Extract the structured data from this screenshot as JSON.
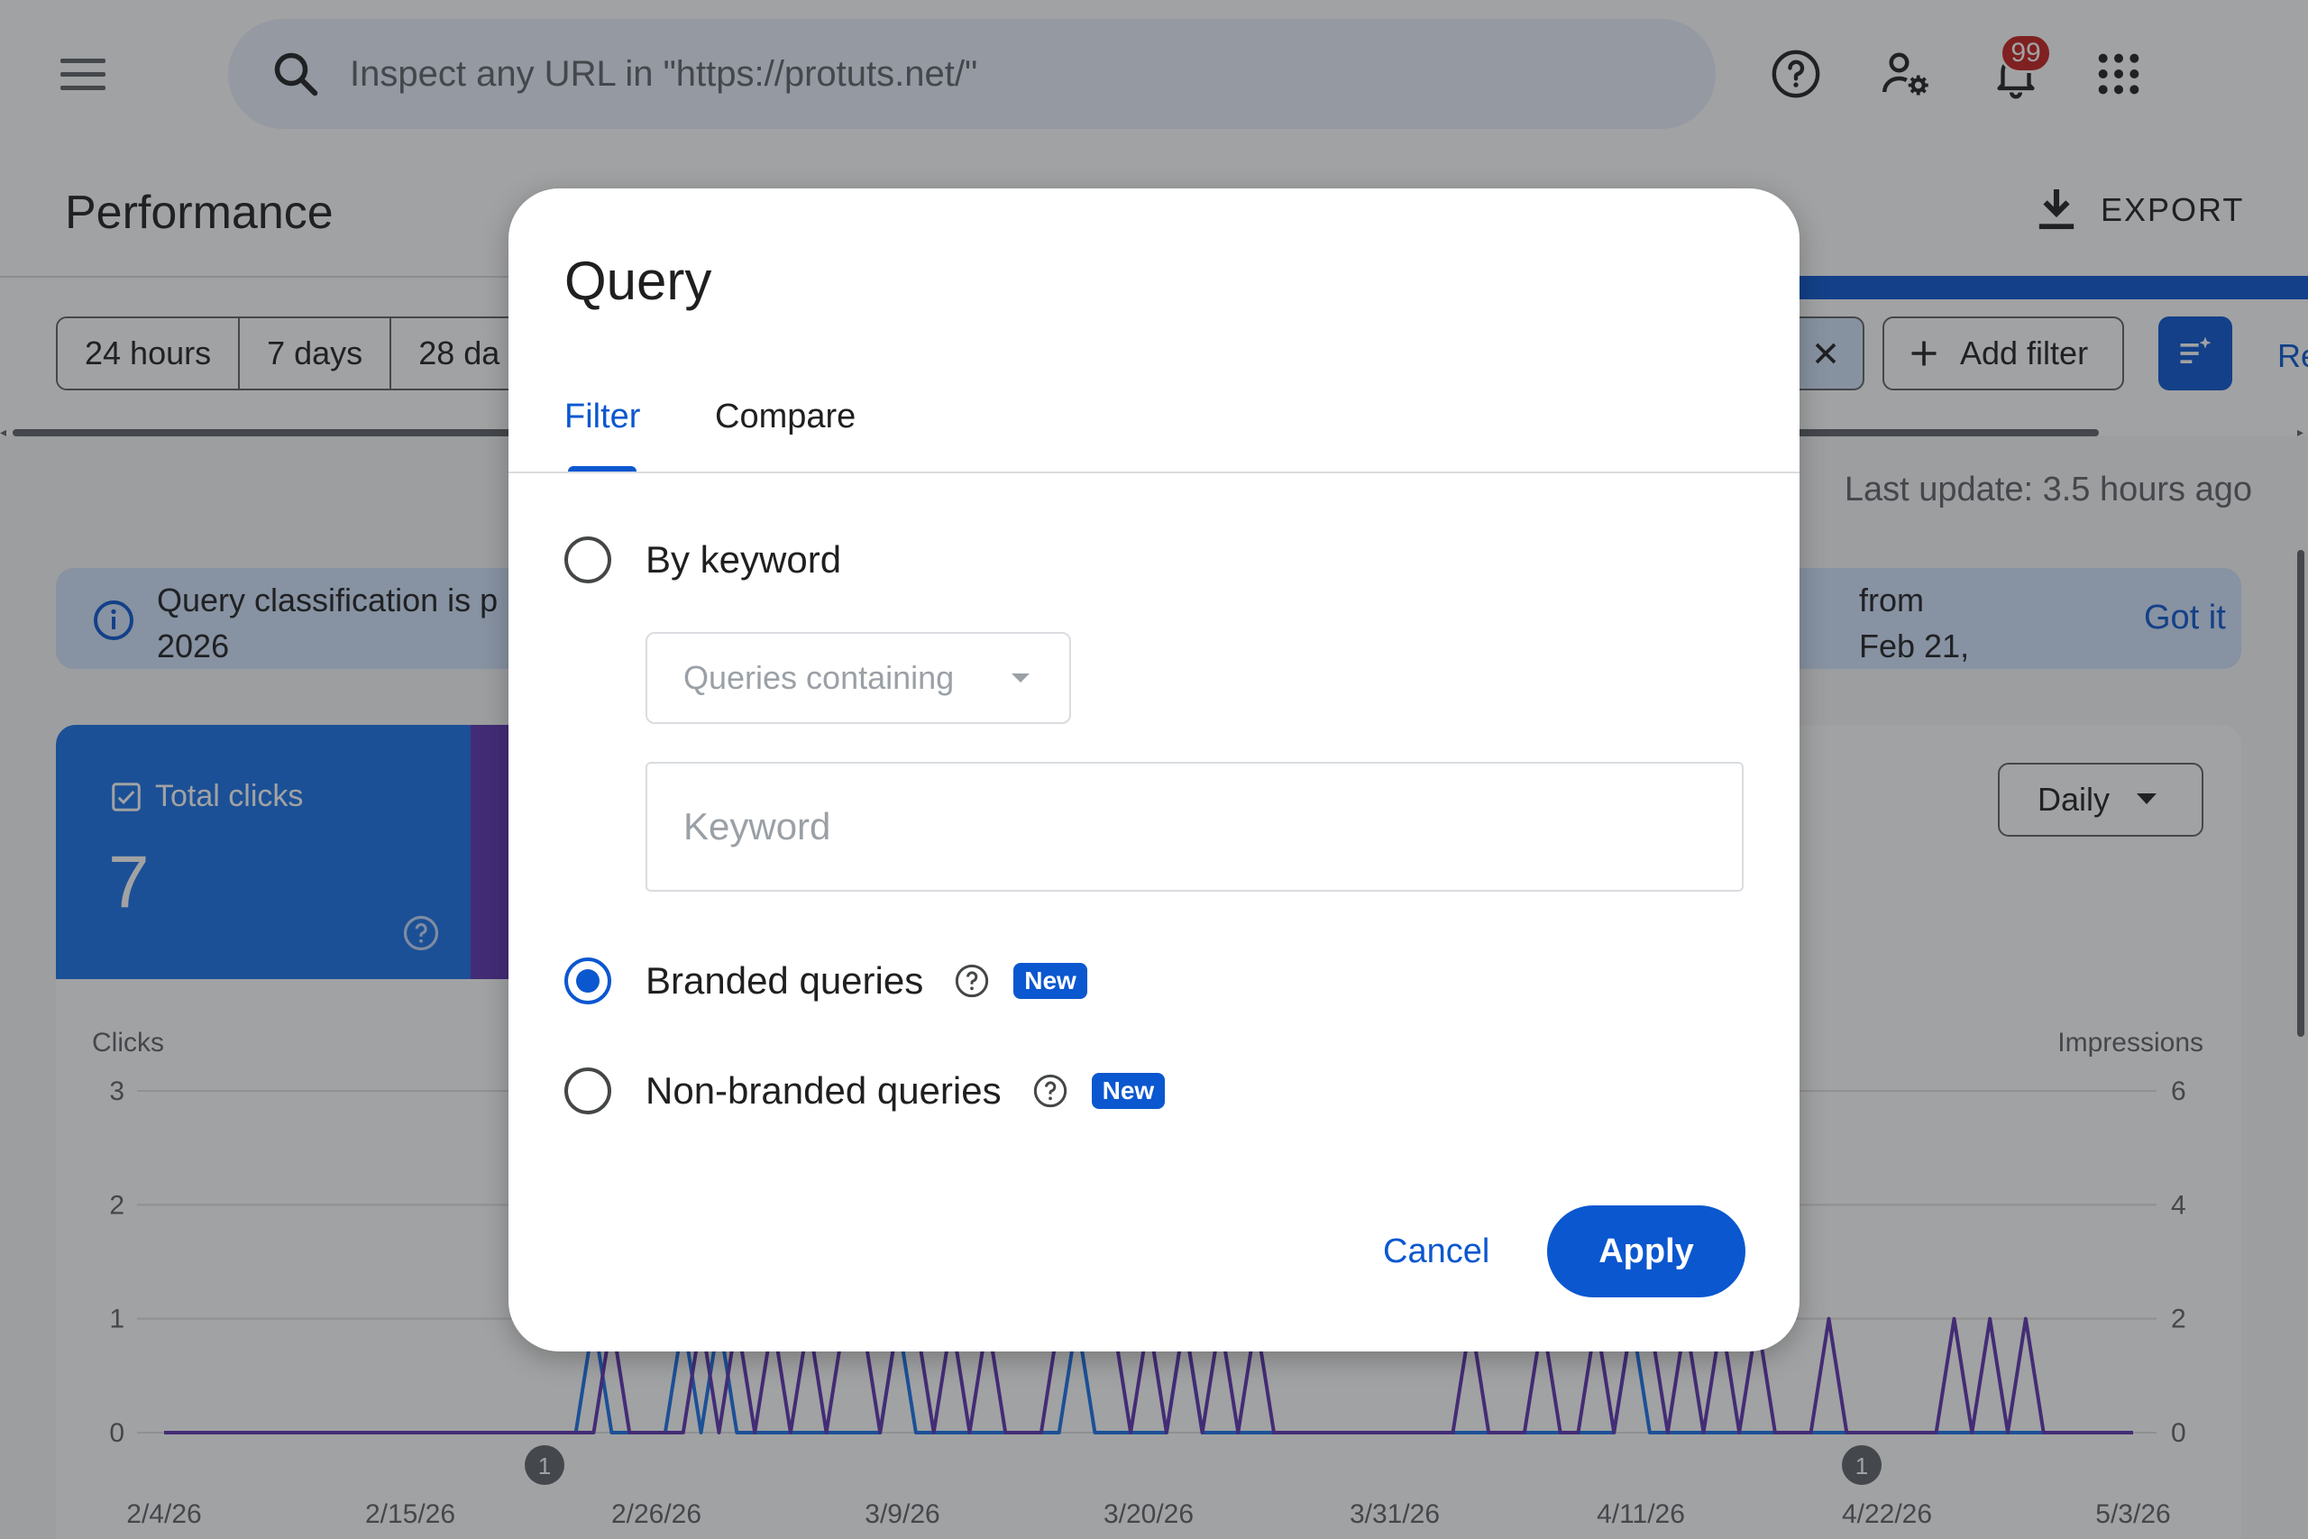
{
  "topbar": {
    "search_placeholder": "Inspect any URL in \"https://protuts.net/\"",
    "notification_count": "99"
  },
  "page": {
    "title": "Performance",
    "export_label": "EXPORT",
    "last_update": "Last update: 3.5 hours ago"
  },
  "date_ranges": [
    "24 hours",
    "7 days",
    "28 da"
  ],
  "filters": {
    "add_filter_label": "Add filter",
    "reset_label": "Re"
  },
  "banner": {
    "text_left": "Query classification is p",
    "text_left_line2": "2026",
    "text_right": "from Feb 21,",
    "got_it": "Got it"
  },
  "metric": {
    "label": "Total clicks",
    "value": "7"
  },
  "granularity": "Daily",
  "dialog": {
    "title": "Query",
    "tabs": [
      {
        "label": "Filter",
        "active": true
      },
      {
        "label": "Compare",
        "active": false
      }
    ],
    "options": {
      "by_keyword": "By keyword",
      "match_type": "Queries containing",
      "keyword_placeholder": "Keyword",
      "branded": "Branded queries",
      "non_branded": "Non-branded queries",
      "new_badge": "New"
    },
    "selected": "branded",
    "cancel_label": "Cancel",
    "apply_label": "Apply"
  },
  "chart_data": {
    "type": "line",
    "ylabel_left": "Clicks",
    "ylabel_right": "Impressions",
    "y_left_ticks": [
      "3",
      "2",
      "1",
      "0"
    ],
    "y_right_ticks": [
      "6",
      "4",
      "2",
      "0"
    ],
    "x_tick_labels": [
      "2/4/26",
      "2/15/26",
      "2/26/26",
      "3/9/26",
      "3/20/26",
      "3/31/26",
      "4/11/26",
      "4/22/26",
      "5/3/26"
    ],
    "annotations": [
      "1",
      "1"
    ],
    "ylim_left": [
      0,
      3
    ],
    "ylim_right": [
      0,
      6
    ],
    "series": [
      {
        "color": "#1a73e8",
        "values": [
          0,
          0,
          0,
          0,
          0,
          0,
          0,
          0,
          0,
          0,
          0,
          0,
          0,
          0,
          0,
          0,
          0,
          0,
          0,
          0,
          0,
          0,
          0,
          0,
          1,
          0,
          0,
          0,
          0,
          1,
          0,
          1,
          0,
          0,
          0,
          0,
          0,
          0,
          0,
          0,
          0,
          1,
          0,
          0,
          0,
          0,
          0,
          0,
          0,
          0,
          0,
          1,
          0,
          0,
          0,
          0,
          0,
          1,
          0,
          0,
          0,
          0,
          0,
          0,
          0,
          0,
          0,
          0,
          0,
          0,
          0,
          0,
          0,
          0,
          0,
          0,
          0,
          0,
          0,
          0,
          0,
          0,
          1,
          0,
          0,
          0,
          0,
          0,
          0,
          0,
          0,
          0,
          0,
          0,
          0,
          0,
          0,
          0,
          0,
          0,
          0,
          0,
          0,
          0,
          0,
          0,
          0,
          0,
          0,
          0,
          0
        ]
      },
      {
        "color": "#5e35b1",
        "values": [
          0,
          0,
          0,
          0,
          0,
          0,
          0,
          0,
          0,
          0,
          0,
          0,
          0,
          0,
          0,
          0,
          0,
          0,
          0,
          0,
          0,
          0,
          0,
          0,
          0,
          1,
          0,
          0,
          0,
          0,
          1,
          0,
          1,
          0,
          1,
          0,
          1,
          0,
          1,
          1,
          0,
          1,
          1,
          0,
          1,
          0,
          1,
          0,
          0,
          0,
          1,
          1,
          1,
          1,
          0,
          1,
          0,
          1,
          0,
          1,
          0,
          1,
          0,
          0,
          0,
          0,
          0,
          0,
          0,
          0,
          0,
          0,
          0,
          1,
          0,
          0,
          0,
          1,
          0,
          0,
          1,
          0,
          1,
          1,
          0,
          1,
          0,
          1,
          0,
          1,
          0,
          0,
          0,
          1,
          0,
          0,
          0,
          0,
          0,
          0,
          1,
          0,
          1,
          0,
          1,
          0,
          0,
          0,
          0,
          0,
          0
        ]
      }
    ]
  }
}
